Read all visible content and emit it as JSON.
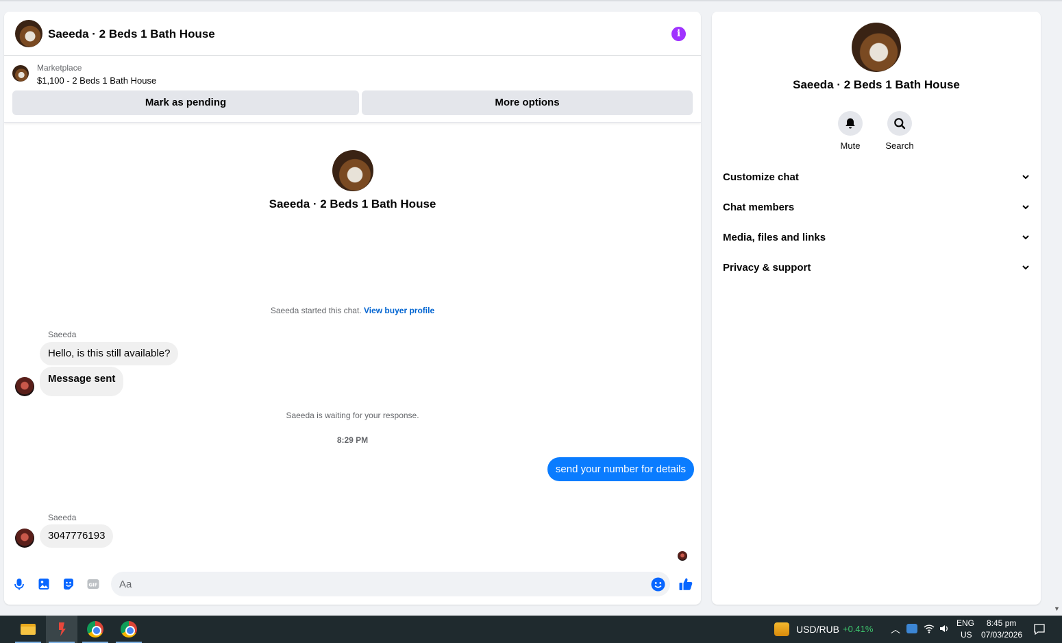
{
  "chat": {
    "title": "Saeeda · 2 Beds 1 Bath House",
    "listing": {
      "label": "Marketplace",
      "price_title": "$1,100 - 2 Beds 1 Bath House",
      "pending_button": "Mark as pending",
      "more_button": "More options"
    },
    "intro_title": "Saeeda · 2 Beds 1 Bath House",
    "started_text": "Saeeda started this chat.",
    "view_profile": "View buyer profile",
    "messages": [
      {
        "sender": "Saeeda",
        "text": "Hello, is this still available?"
      },
      {
        "text": "Message sent"
      }
    ],
    "waiting_text": "Saeeda is waiting for your response.",
    "time": "8:29 PM",
    "outgoing": "send your number for details",
    "reply": {
      "sender": "Saeeda",
      "text": "3047776193"
    },
    "composer": {
      "placeholder": "Aa"
    }
  },
  "side": {
    "title": "Saeeda · 2 Beds 1 Bath House",
    "actions": [
      {
        "label": "Mute",
        "icon": "bell-icon"
      },
      {
        "label": "Search",
        "icon": "search-icon"
      }
    ],
    "sections": [
      "Customize chat",
      "Chat members",
      "Media, files and links",
      "Privacy & support"
    ]
  },
  "taskbar": {
    "ticker": "USD/RUB",
    "change": "+0.41%",
    "lang_top": "ENG",
    "lang_bottom": "US",
    "clock_time": "8:45 pm",
    "clock_date": "07/03/2026"
  },
  "colors": {
    "accent": "#0866ff",
    "outgoing_bubble": "#0a7cff",
    "info": "#a033ff",
    "ticker_positive": "#3ec46d"
  }
}
